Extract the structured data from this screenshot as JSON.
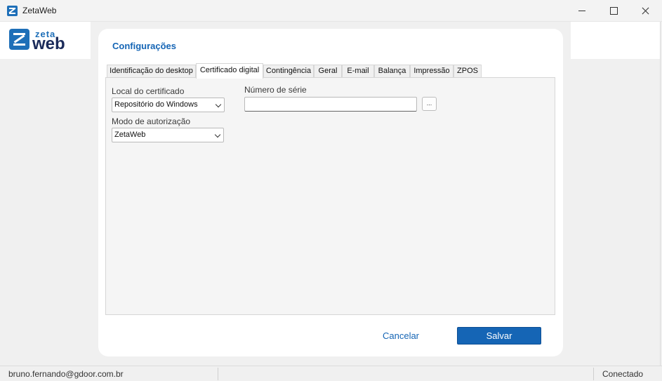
{
  "window": {
    "title": "ZetaWeb"
  },
  "logo": {
    "top": "zeta",
    "bottom": "web"
  },
  "page": {
    "title": "Configurações"
  },
  "tabs": [
    "Identificação do desktop",
    "Certificado digital",
    "Contingência",
    "Geral",
    "E-mail",
    "Balança",
    "Impressão",
    "ZPOS"
  ],
  "active_tab": "Certificado digital",
  "form": {
    "local_label": "Local do certificado",
    "local_value": "Repositório do Windows",
    "modo_label": "Modo de autorização",
    "modo_value": "ZetaWeb",
    "serie_label": "Número de série",
    "serie_value": "",
    "browse_label": "..."
  },
  "actions": {
    "cancel": "Cancelar",
    "save": "Salvar"
  },
  "status": {
    "user": "bruno.fernando@gdoor.com.br",
    "connection": "Conectado"
  },
  "colors": {
    "accent": "#1565b5",
    "brand_dark": "#1b2b5a"
  }
}
